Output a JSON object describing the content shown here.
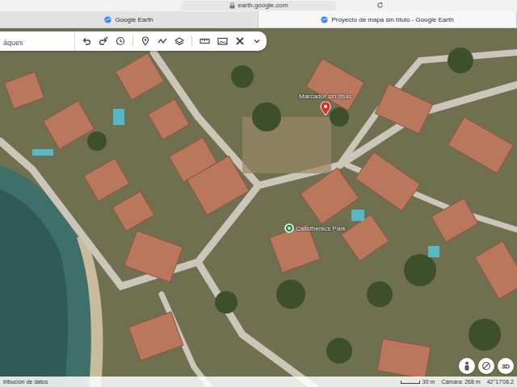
{
  "browser": {
    "address": "earth.google.com",
    "tabs": [
      {
        "label": "Google Earth",
        "selected": false
      },
      {
        "label": "Proyecto de mapa sin título - Google Earth",
        "selected": true
      }
    ]
  },
  "search": {
    "text": "áques"
  },
  "map": {
    "placemarks": [
      {
        "label": "Marcador sin título",
        "color": "#d93025"
      },
      {
        "label": "Calisthenics Park",
        "color": "#1e8e3e"
      }
    ]
  },
  "view_buttons": [
    "3D"
  ],
  "status_bar": {
    "attribution": "tribución de datos",
    "scale": "30 m",
    "camera": "Cámara: 268 m",
    "coordinates": "42°17'06.2"
  }
}
